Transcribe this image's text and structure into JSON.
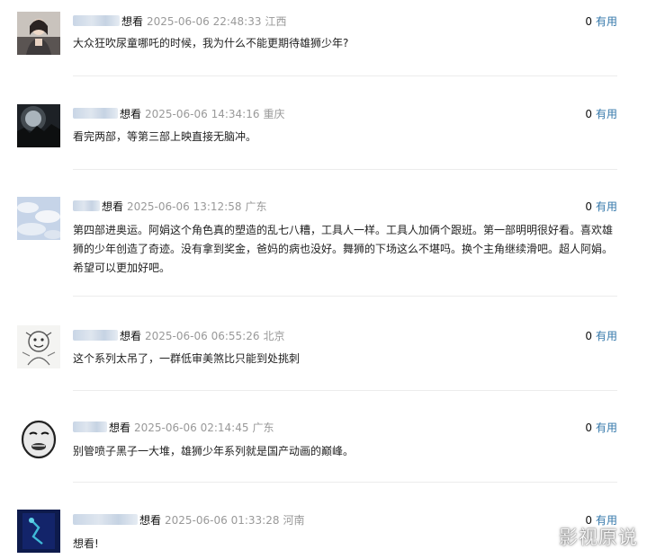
{
  "comments": [
    {
      "want": "想看",
      "time": "2025-06-06 22:48:33",
      "location": "江西",
      "count": "0",
      "vote_label": "有用",
      "text": "大众狂吹尿童哪吒的时候，我为什么不能更期待雄狮少年?"
    },
    {
      "want": "想看",
      "time": "2025-06-06 14:34:16",
      "location": "重庆",
      "count": "0",
      "vote_label": "有用",
      "text": "看完两部，等第三部上映直接无脑冲。"
    },
    {
      "want": "想看",
      "time": "2025-06-06 13:12:58",
      "location": "广东",
      "count": "0",
      "vote_label": "有用",
      "text": "第四部进奥运。阿娟这个角色真的塑造的乱七八糟，工具人一样。工具人加俩个跟班。第一部明明很好看。喜欢雄狮的少年创造了奇迹。没有拿到奖金，爸妈的病也没好。舞狮的下场这么不堪吗。换个主角继续滑吧。超人阿娟。希望可以更加好吧。"
    },
    {
      "want": "想看",
      "time": "2025-06-06 06:55:26",
      "location": "北京",
      "count": "0",
      "vote_label": "有用",
      "text": "这个系列太吊了，一群低审美煞比只能到处挑刺"
    },
    {
      "want": "想看",
      "time": "2025-06-06 02:14:45",
      "location": "广东",
      "count": "0",
      "vote_label": "有用",
      "text": "别管喷子黑子一大堆，雄狮少年系列就是国产动画的巅峰。"
    },
    {
      "want": "想看",
      "time": "2025-06-06 01:33:28",
      "location": "河南",
      "count": "0",
      "vote_label": "有用",
      "text": "想看!"
    }
  ],
  "watermark": "影视原说"
}
